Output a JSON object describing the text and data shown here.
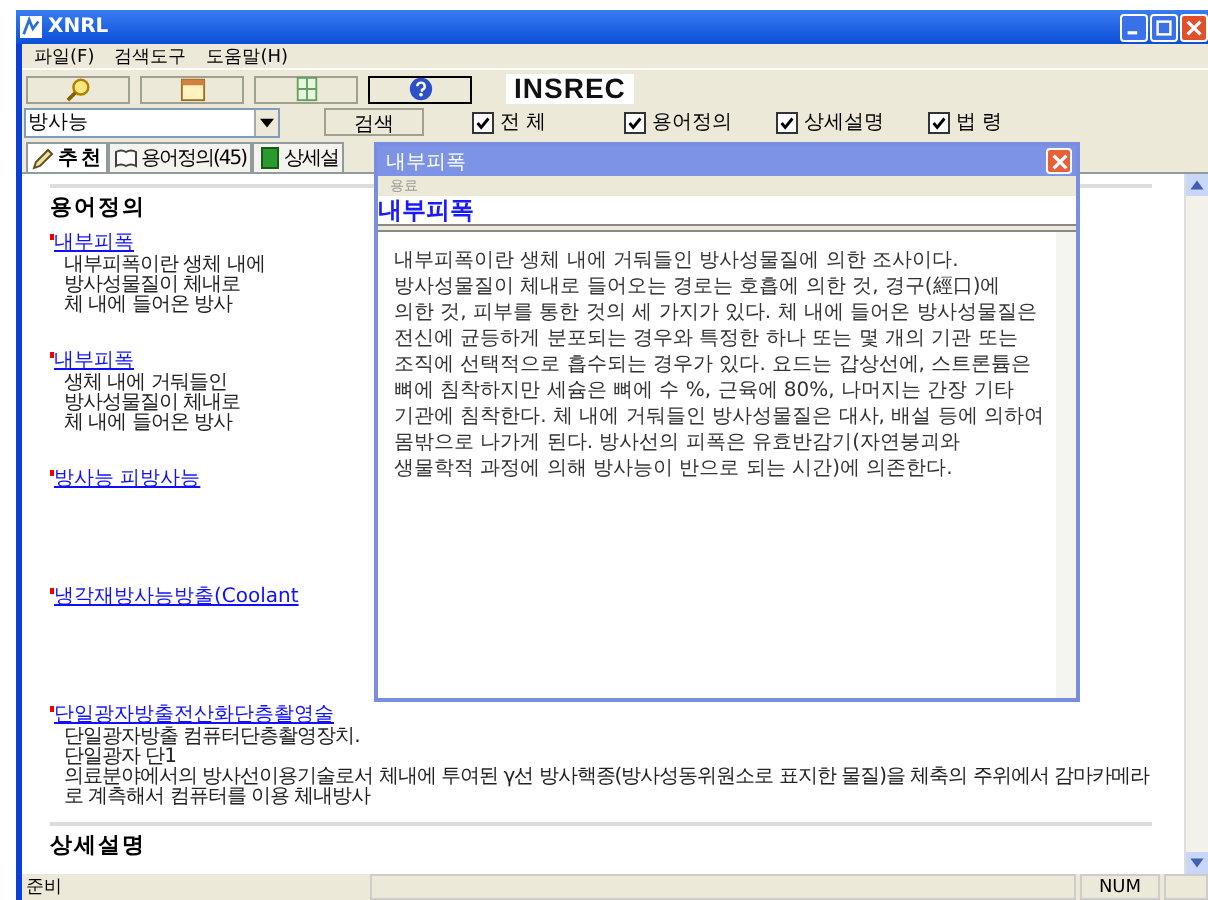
{
  "window": {
    "title": "XNRL"
  },
  "menu": [
    "파일(F)",
    "검색도구",
    "도움말(H)"
  ],
  "toolbar": [
    {
      "kind": "search",
      "selected": false
    },
    {
      "kind": "folder",
      "selected": false
    },
    {
      "kind": "book",
      "selected": false
    },
    {
      "kind": "help",
      "selected": true
    }
  ],
  "logo": "INSREC",
  "search": {
    "value": "방사능",
    "button": "검색",
    "filters": [
      {
        "label": "전 체",
        "checked": true
      },
      {
        "label": "용어정의",
        "checked": true
      },
      {
        "label": "상세설명",
        "checked": true
      },
      {
        "label": "법 령",
        "checked": true
      }
    ]
  },
  "tabs": [
    {
      "label": "추 천",
      "kind": "home",
      "selected": true
    },
    {
      "label": "용어정의(45)",
      "kind": "book",
      "selected": false
    },
    {
      "label": "상세설",
      "kind": "green",
      "selected": false
    }
  ],
  "content": {
    "heading": "용어정의",
    "entries": [
      {
        "link": "내부피폭",
        "lines": [
          "내부피폭이란 생체 내에",
          "방사성물질이 체내로",
          "체 내에 들어온 방사"
        ]
      },
      {
        "link": "내부피폭",
        "lines": [
          "생체 내에 거둬들인",
          "방사성물질이 체내로",
          "체 내에 들어온 방사"
        ]
      },
      {
        "link": "방사능 피방사능"
      },
      {
        "link": "냉각재방사능방출(Coolant"
      },
      {
        "link": "단일광자방출전산화단층촬영술",
        "lines": [
          "단일광자방출 컴퓨터단층촬영장치.",
          "단일광자 단1",
          "의료분야에서의 방사선이용기술로서 체내에 투여된 γ선 방사핵종(방사성동위원소로 표지한 물질)을 체축의 주위에서 감마카메라로 계측해서 컴퓨터를 이용 체내방사"
        ]
      }
    ],
    "section_heading": "상세설명"
  },
  "popup": {
    "title": "내부피폭",
    "menu": "용료",
    "heading": "내부피폭",
    "body": "내부피폭이란 생체 내에 거둬들인 방사성물질에 의한 조사이다. 방사성물질이 체내로 들어오는 경로는 호흡에 의한 것, 경구(經口)에 의한 것, 피부를 통한 것의 세 가지가 있다. 체 내에 들어온 방사성물질은 전신에 균등하게 분포되는 경우와 특정한 하나 또는 몇 개의 기관 또는 조직에 선택적으로 흡수되는 경우가 있다. 요드는 갑상선에, 스트론튬은 뼈에 침착하지만 세슘은 뼈에 수 %, 근육에 80%, 나머지는 간장 기타 기관에 침착한다. 체 내에 거둬들인 방사성물질은 대사, 배설 등에 의하여 몸밖으로 나가게 된다. 방사선의 피폭은 유효반감기(자연붕괴와 생물학적 과정에 의해 방사능이 반으로 되는 시간)에 의존한다."
  },
  "status_bar": {
    "text": "준비",
    "indicator": "NUM"
  }
}
